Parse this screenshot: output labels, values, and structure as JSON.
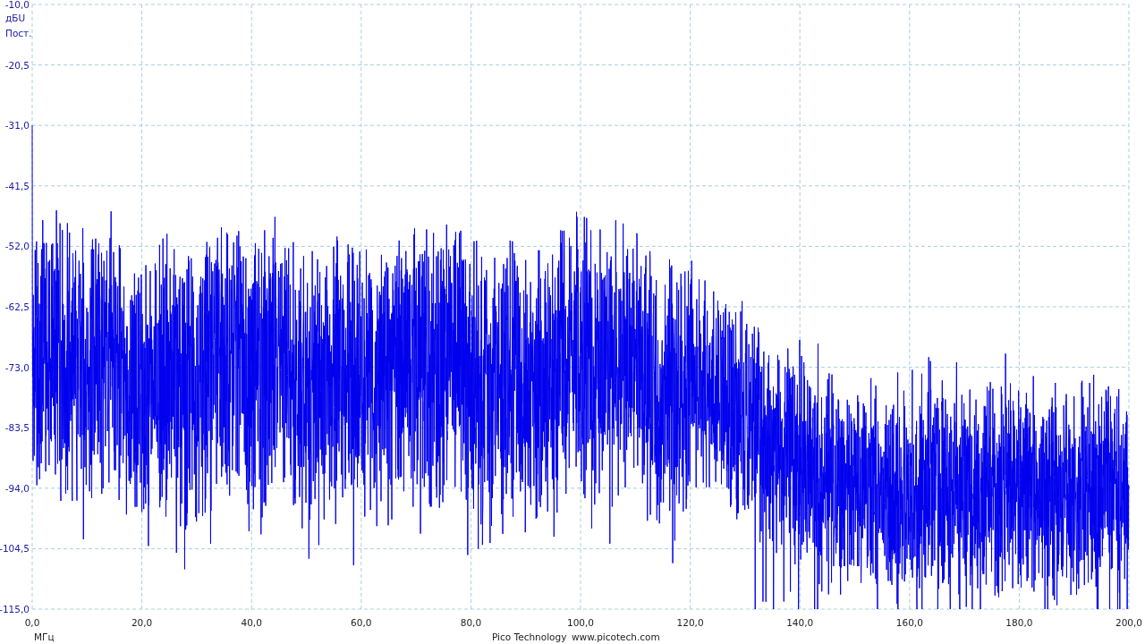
{
  "y_axis": {
    "ticks": [
      "-10,0",
      "-20,5",
      "-31,0",
      "-41,5",
      "-52,0",
      "-62,5",
      "-73,0",
      "-83,5",
      "-94,0",
      "-104,5",
      "-115,0"
    ],
    "unit": "дБU",
    "coupling": "Пост."
  },
  "x_axis": {
    "ticks": [
      "0,0",
      "20,0",
      "40,0",
      "60,0",
      "80,0",
      "100,0",
      "120,0",
      "140,0",
      "160,0",
      "180,0",
      "200,0"
    ],
    "unit": "МГц"
  },
  "footer": {
    "company": "Pico Technology",
    "website": "www.picotech.com"
  }
}
